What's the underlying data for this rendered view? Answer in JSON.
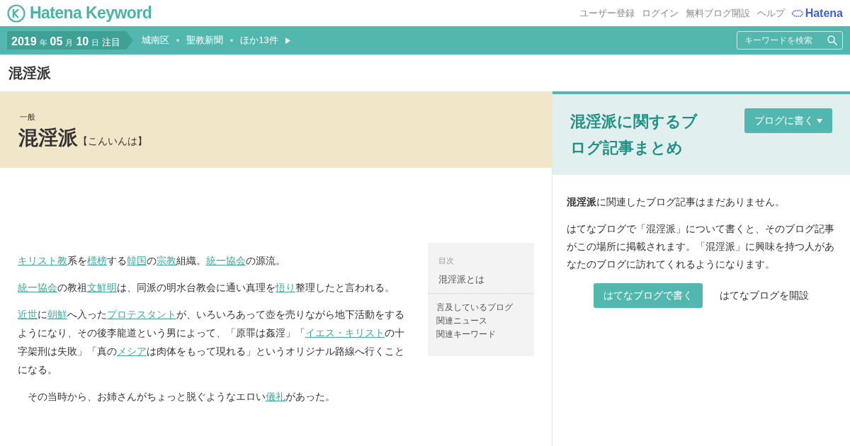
{
  "header": {
    "logo": "Hatena Keyword",
    "links": [
      "ユーザー登録",
      "ログイン",
      "無料ブログ開設",
      "ヘルプ"
    ],
    "brand": "Hatena"
  },
  "topbar": {
    "date": [
      {
        "text": "2019",
        "kind": "num"
      },
      {
        "text": "年",
        "kind": "unit"
      },
      {
        "text": "05",
        "kind": "num"
      },
      {
        "text": "月",
        "kind": "unit"
      },
      {
        "text": "10",
        "kind": "num"
      },
      {
        "text": "日",
        "kind": "unit"
      },
      {
        "text": "注目",
        "kind": "label"
      }
    ],
    "topics": [
      "城南区",
      "聖教新聞"
    ],
    "more": "ほか13件",
    "search": {
      "placeholder": "キーワードを検索"
    }
  },
  "page_title": "混淫派",
  "entry": {
    "category": "一般",
    "title": "混淫派",
    "reading": "【こんいんは】",
    "paragraphs": [
      [
        {
          "text": "キリスト教",
          "link": true
        },
        {
          "text": "系を",
          "link": false
        },
        {
          "text": "標榜",
          "link": true
        },
        {
          "text": "する",
          "link": false
        },
        {
          "text": "韓国",
          "link": true
        },
        {
          "text": "の",
          "link": false
        },
        {
          "text": "宗教",
          "link": true
        },
        {
          "text": "組織。",
          "link": false
        },
        {
          "text": "統一協会",
          "link": true
        },
        {
          "text": "の源流。",
          "link": false
        }
      ],
      [
        {
          "text": "統一協会",
          "link": true
        },
        {
          "text": "の教祖",
          "link": false
        },
        {
          "text": "文鮮明",
          "link": true
        },
        {
          "text": "は、同派の明水台教会に通い真理を",
          "link": false
        },
        {
          "text": "悟り",
          "link": true
        },
        {
          "text": "整理したと言われる。",
          "link": false
        }
      ],
      [
        {
          "text": "近世",
          "link": true
        },
        {
          "text": "に",
          "link": false
        },
        {
          "text": "朝鮮",
          "link": true
        },
        {
          "text": "へ入った",
          "link": false
        },
        {
          "text": "プロテスタント",
          "link": true
        },
        {
          "text": "が、いろいろあって壺を売りながら地下活動をするようになり、その後李龍道という男によって、「原罪は姦淫」「",
          "link": false
        },
        {
          "text": "イエス・キリスト",
          "link": true
        },
        {
          "text": "の十字架刑は失敗」「真の",
          "link": false
        },
        {
          "text": "メシア",
          "link": true
        },
        {
          "text": "は肉体をもって現れる」というオリジナル路線へ行くことになる。",
          "link": false
        }
      ],
      [
        {
          "text": "　その当時から、お姉さんがちょっと脱ぐようなエロい",
          "link": false
        },
        {
          "text": "儀礼",
          "link": true
        },
        {
          "text": "があった。",
          "link": false
        }
      ]
    ],
    "toc": {
      "heading": "目次",
      "items": [
        "混淫派とは"
      ],
      "links": [
        "言及しているブログ",
        "関連ニュース",
        "関連キーワード"
      ]
    }
  },
  "blog_panel": {
    "title": "混淫派に関するブログ記事まとめ",
    "write_button": "ブログに書く",
    "empty_bold": "混淫派",
    "empty_rest": "に関連したブログ記事はまだありません。",
    "info": "はてなブログで「混淫派」について書くと、そのブログ記事がこの場所に掲載されます。「混淫派」に興味を持つ人があなたのブログに訪れてくれるようになります。",
    "primary_button": "はてなブログで書く",
    "secondary_link": "はてなブログを開設"
  }
}
